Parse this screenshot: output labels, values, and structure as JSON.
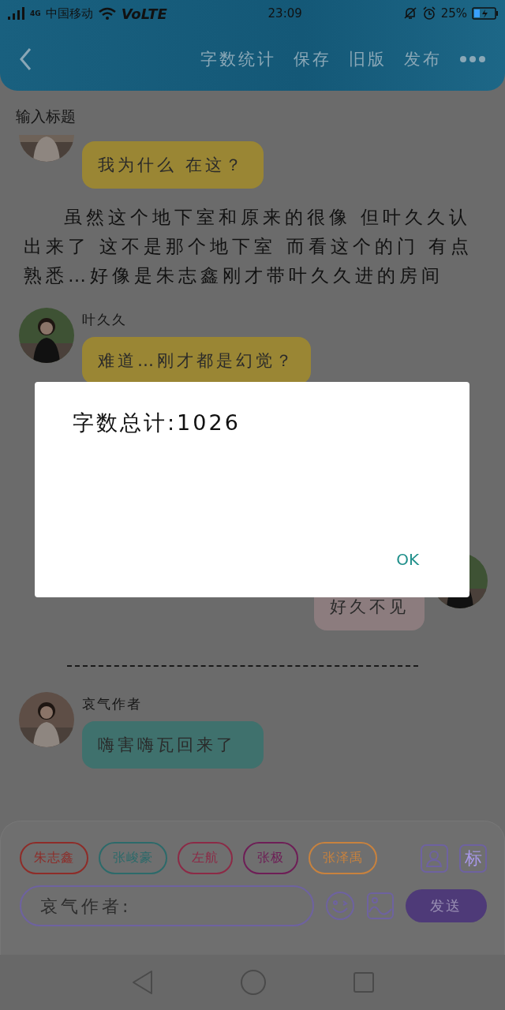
{
  "status_bar": {
    "network": "4G",
    "carrier": "中国移动",
    "volte": "VoLTE",
    "time": "23:09",
    "battery": "25%"
  },
  "toolbar": {
    "actions": [
      "字数统计",
      "保存",
      "旧版",
      "发布"
    ]
  },
  "title_field": {
    "placeholder": "输入标题"
  },
  "messages": [
    {
      "kind": "left",
      "bubble": "我为什么 在这？",
      "color": "#9a8634"
    },
    {
      "kind": "narration",
      "text": "虽然这个地下室和原来的很像 但叶久久认出来了 这不是那个地下室 而看这个的门 有点熟悉…好像是朱志鑫刚才带叶久久进的房间"
    },
    {
      "kind": "left",
      "name": "叶久久",
      "bubble": "难道…刚才都是幻觉？",
      "color": "#9a8634"
    },
    {
      "kind": "right",
      "bubble": "好久不见",
      "color": "#8c7c7e"
    },
    {
      "kind": "divider"
    },
    {
      "kind": "left",
      "name": "哀气作者",
      "bubble": "嗨害嗨瓦回来了",
      "color": "#3f716d"
    }
  ],
  "characters": [
    {
      "name": "朱志鑫",
      "color": "#8e2c28"
    },
    {
      "name": "张峻豪",
      "color": "#2c6a6a"
    },
    {
      "name": "左航",
      "color": "#8c2a46"
    },
    {
      "name": "张极",
      "color": "#6e1e56"
    },
    {
      "name": "张泽禹",
      "color": "#c8823e"
    }
  ],
  "tag_button": "标",
  "composer": {
    "placeholder": "哀气作者:",
    "send": "发送"
  },
  "dialog": {
    "message": "字数总计:1026",
    "ok": "OK"
  }
}
